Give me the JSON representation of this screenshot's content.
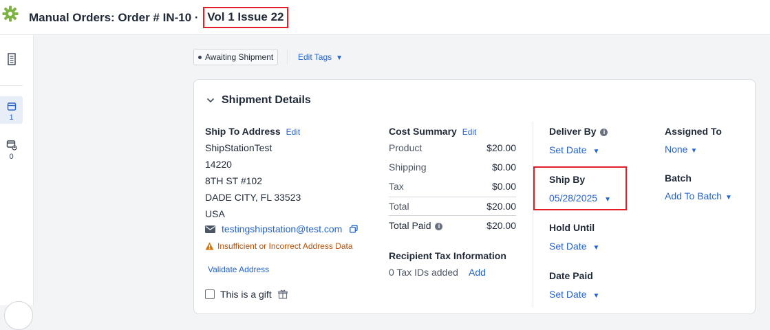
{
  "header": {
    "title_prefix": "Manual Orders:  Order # IN-10 · ",
    "title_highlight": "Vol 1 Issue 22"
  },
  "rail": {
    "shipments_count": "1",
    "returns_count": "0"
  },
  "toolbar": {
    "status_tag": "Awaiting Shipment",
    "edit_tags": "Edit Tags"
  },
  "shipment": {
    "section_title": "Shipment Details",
    "ship_to": {
      "label": "Ship To Address",
      "edit": "Edit",
      "lines": [
        "ShipStationTest",
        "14220",
        "8TH ST #102",
        "DADE CITY, FL 33523",
        "USA"
      ],
      "email": "testingshipstation@test.com",
      "warning": "Insufficient or Incorrect Address Data",
      "validate": "Validate Address",
      "gift": "This is a gift"
    },
    "cost_summary": {
      "label": "Cost Summary",
      "edit": "Edit",
      "rows": [
        {
          "name": "Product",
          "value": "$20.00"
        },
        {
          "name": "Shipping",
          "value": "$0.00"
        },
        {
          "name": "Tax",
          "value": "$0.00"
        },
        {
          "name": "Total",
          "value": "$20.00"
        }
      ],
      "total_paid_label": "Total Paid",
      "total_paid_value": "$20.00"
    },
    "tax": {
      "label": "Recipient Tax Information",
      "count": "0 Tax IDs added",
      "add": "Add"
    },
    "dates": {
      "deliver_by_label": "Deliver By",
      "deliver_by_value": "Set Date",
      "ship_by_label": "Ship By",
      "ship_by_value": "05/28/2025",
      "hold_until_label": "Hold Until",
      "hold_until_value": "Set Date",
      "date_paid_label": "Date Paid",
      "date_paid_value": "Set Date"
    },
    "assignment": {
      "assigned_label": "Assigned To",
      "assigned_value": "None",
      "batch_label": "Batch",
      "batch_value": "Add To Batch"
    }
  },
  "colors": {
    "accent_link": "#2563c9",
    "highlight_box": "#e11d2a",
    "warning": "#b45309",
    "logo_green": "#7cb342"
  }
}
